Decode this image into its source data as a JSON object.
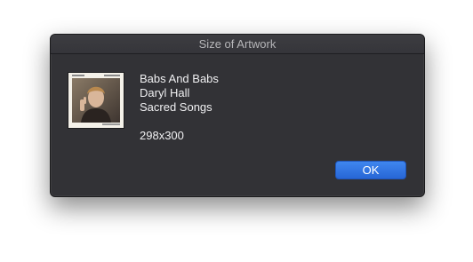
{
  "window": {
    "title": "Size of Artwork"
  },
  "track": {
    "name": "Babs And Babs",
    "artist": "Daryl Hall",
    "album": "Sacred Songs",
    "dimensions": "298x300"
  },
  "buttons": {
    "ok_label": "OK"
  },
  "colors": {
    "dialog_background": "#323236",
    "accent": "#2f72e2",
    "text": "#f0f0f2",
    "title_text": "#b5b5b8"
  }
}
